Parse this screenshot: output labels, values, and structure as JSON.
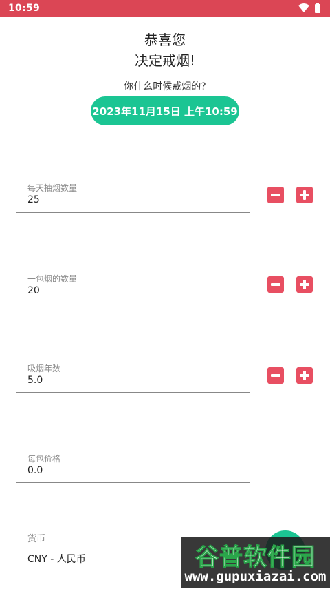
{
  "status_bar": {
    "time": "10:59",
    "wifi_icon": "wifi-icon",
    "battery_icon": "battery-icon"
  },
  "header": {
    "line1": "恭喜您",
    "line2": "决定戒烟!"
  },
  "quit_date": {
    "question": "你什么时候戒烟的?",
    "button_label": "2023年11月15日 上午10:59"
  },
  "fields": [
    {
      "label": "每天抽烟数量",
      "value": "25"
    },
    {
      "label": "一包烟的数量",
      "value": "20"
    },
    {
      "label": "吸烟年数",
      "value": "5.0"
    },
    {
      "label": "每包价格",
      "value": "0.0"
    }
  ],
  "currency": {
    "label": "货币",
    "value": "CNY - 人民币"
  },
  "watermark": {
    "cn": "谷普软件园",
    "url": "www.gupuxiazai.com"
  },
  "colors": {
    "status_bar": "#db4655",
    "accent_green": "#1bc593",
    "stepper_red": "#e84f62"
  }
}
